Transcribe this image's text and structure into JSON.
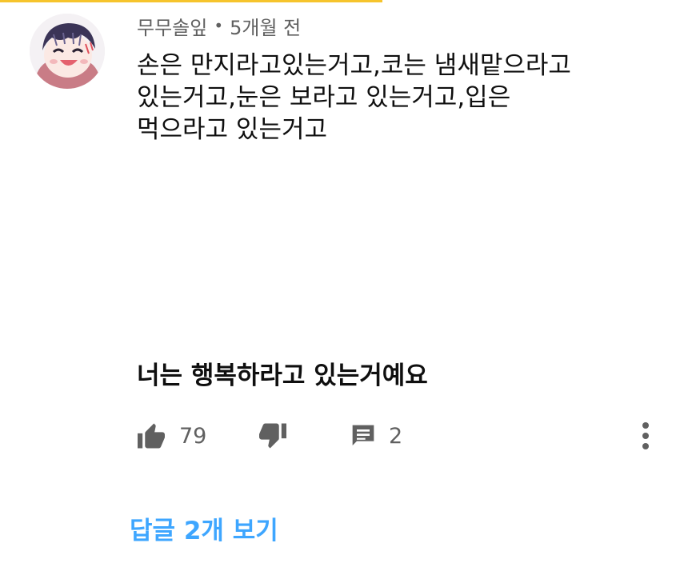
{
  "comment": {
    "author": "무무솔잎",
    "separator": "•",
    "time": "5개월 전",
    "body_lines": [
      "손은 만지라고있는거고,코는 냄새맡으라고",
      "있는거고,눈은 보라고 있는거고,입은",
      "먹으라고 있는거고"
    ],
    "emphasis_line": "너는 행복하라고 있는거예요"
  },
  "actions": {
    "like_icon": "thumbs-up-icon",
    "like_count": "79",
    "dislike_icon": "thumbs-down-icon",
    "reply_icon": "comment-icon",
    "reply_count": "2",
    "more_icon": "more-vertical-icon"
  },
  "replies": {
    "label": "답글 2개 보기"
  },
  "colors": {
    "accent_bar": "#f6c42c",
    "link": "#3ea6ff",
    "secondary_text": "#606060",
    "icon": "#606060"
  }
}
